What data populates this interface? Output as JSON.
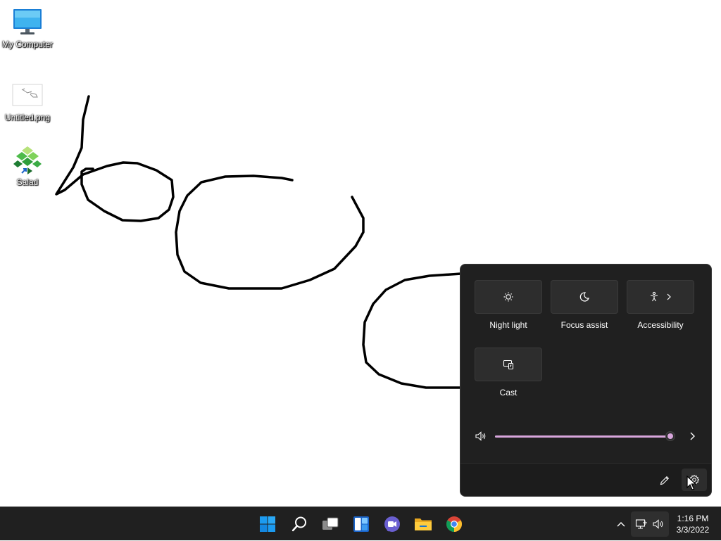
{
  "desktop": {
    "icons": [
      {
        "label": "My Computer",
        "icon": "monitor-icon"
      },
      {
        "label": "Untitled.png",
        "icon": "image-file-icon"
      },
      {
        "label": "Salad",
        "icon": "salad-app-icon"
      }
    ]
  },
  "quick_settings": {
    "tiles": [
      {
        "label": "Night light",
        "icon": "night-light-icon"
      },
      {
        "label": "Focus assist",
        "icon": "moon-icon"
      },
      {
        "label": "Accessibility",
        "icon": "accessibility-icon"
      },
      {
        "label": "Cast",
        "icon": "cast-icon"
      }
    ],
    "volume": {
      "level": 0.99,
      "accent": "#d8a6dc"
    },
    "footer": {
      "edit_icon": "pencil-icon",
      "settings_icon": "gear-icon"
    }
  },
  "taskbar": {
    "apps": [
      {
        "name": "Start",
        "icon": "windows-start-icon"
      },
      {
        "name": "Search",
        "icon": "search-icon"
      },
      {
        "name": "Task View",
        "icon": "task-view-icon"
      },
      {
        "name": "Widgets",
        "icon": "widgets-icon"
      },
      {
        "name": "Chat",
        "icon": "teams-chat-icon"
      },
      {
        "name": "File Explorer",
        "icon": "folder-icon"
      },
      {
        "name": "Google Chrome",
        "icon": "chrome-icon"
      }
    ],
    "tray": {
      "overflow_icon": "chevron-up-icon",
      "network_icon": "network-icon",
      "volume_icon": "speaker-icon"
    },
    "clock": {
      "time": "1:16 PM",
      "date": "3/3/2022"
    }
  }
}
